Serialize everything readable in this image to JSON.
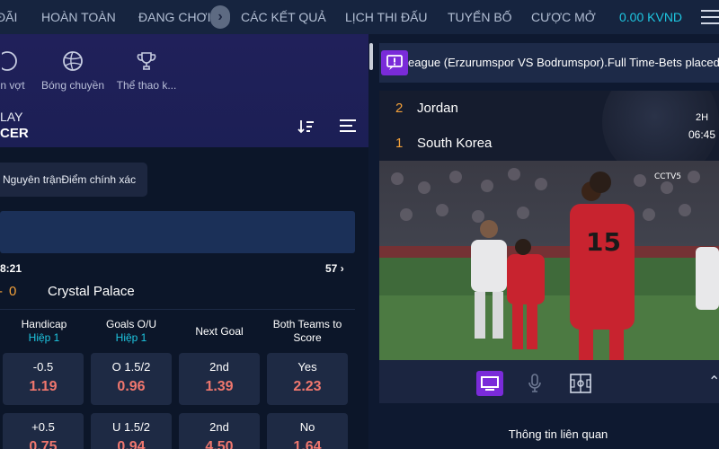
{
  "nav": {
    "items": [
      "ĐÃI",
      "HOÀN TOÀN",
      "ĐANG CHƠI",
      "CÁC KẾT QUẢ",
      "LỊCH THI ĐẤU",
      "TUYỂN BỐ",
      "CƯỢC MỞ"
    ],
    "balance": "0.00 KVND"
  },
  "sports": {
    "items": [
      "n vợt",
      "Bóng chuyền",
      "Thể thao k..."
    ],
    "section_top": "LAY",
    "section_title": "CER"
  },
  "filter": {
    "chip": "Nguyên trậnĐiểm chính xác"
  },
  "match": {
    "time": "8:21",
    "more_count": "57",
    "home_score": "0",
    "away_team": "Crystal Palace"
  },
  "markets": {
    "columns": [
      {
        "title": "Handicap",
        "sub": "Hiệp 1"
      },
      {
        "title": "Goals O/U",
        "sub": "Hiệp 1"
      },
      {
        "title": "Next Goal",
        "sub": ""
      },
      {
        "title": "Both Teams to Score",
        "sub": ""
      }
    ],
    "rows": [
      [
        {
          "label": "-0.5",
          "odds": "1.19"
        },
        {
          "label": "O 1.5/2",
          "odds": "0.96"
        },
        {
          "label": "2nd",
          "odds": "1.39"
        },
        {
          "label": "Yes",
          "odds": "2.23"
        }
      ],
      [
        {
          "label": "+0.5",
          "odds": "0.75"
        },
        {
          "label": "U 1.5/2",
          "odds": "0.94"
        },
        {
          "label": "2nd",
          "odds": "4.50"
        },
        {
          "label": "No",
          "odds": "1.64"
        }
      ]
    ]
  },
  "ticker": {
    "text": "eague (Erzurumspor VS Bodrumspor).Full Time-Bets placed"
  },
  "scoreboard": {
    "team1": {
      "score": "2",
      "name": "Jordan"
    },
    "team2": {
      "score": "1",
      "name": "South Korea"
    },
    "period": "2H",
    "clock": "06:45"
  },
  "video": {
    "broadcaster": "CCTV5"
  },
  "related": {
    "label": "Thông tin liên quan"
  },
  "colors": {
    "accent": "#1ec6e0",
    "odds": "#f0776e",
    "score": "#f3a13a",
    "purple": "#7a2bd9"
  }
}
